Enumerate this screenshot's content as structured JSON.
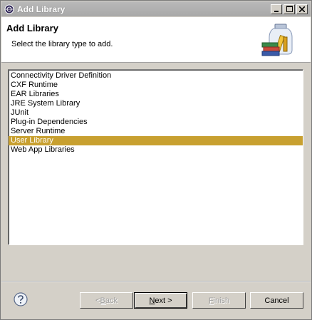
{
  "window": {
    "title": "Add Library"
  },
  "header": {
    "title": "Add Library",
    "description": "Select the library type to add."
  },
  "library_types": [
    "Connectivity Driver Definition",
    "CXF Runtime",
    "EAR Libraries",
    "JRE System Library",
    "JUnit",
    "Plug-in Dependencies",
    "Server Runtime",
    "User Library",
    "Web App Libraries"
  ],
  "selected_index": 7,
  "buttons": {
    "back_prefix": "< ",
    "back_mnemonic": "B",
    "back_rest": "ack",
    "next_mnemonic": "N",
    "next_rest": "ext >",
    "finish_mnemonic": "F",
    "finish_rest": "inish",
    "cancel": "Cancel"
  },
  "colors": {
    "selection": "#c8a030",
    "title_bar": "#a8a8a8"
  },
  "icons": {
    "title": "eclipse-icon",
    "header": "library-jar-icon",
    "help": "help-icon"
  }
}
